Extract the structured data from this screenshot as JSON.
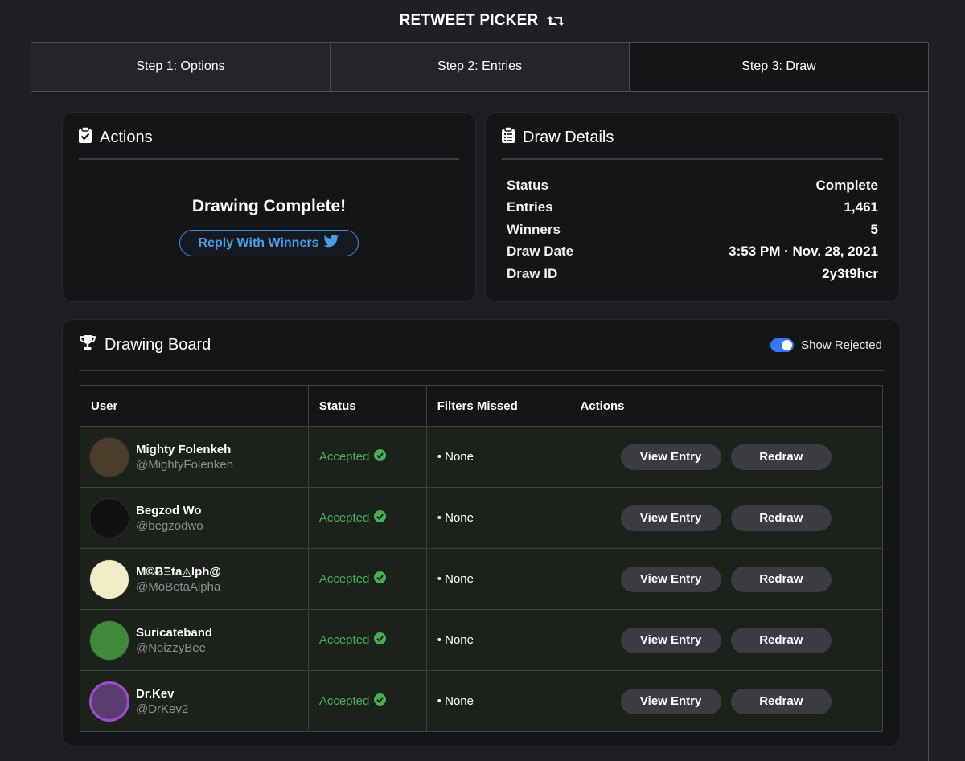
{
  "app": {
    "title": "RETWEET PICKER",
    "title_icon": "retweet-icon"
  },
  "tabs": [
    {
      "label": "Step 1: Options",
      "active": false
    },
    {
      "label": "Step 2: Entries",
      "active": false
    },
    {
      "label": "Step 3: Draw",
      "active": true
    }
  ],
  "actions": {
    "heading": "Actions",
    "icon": "clipboard-check-icon",
    "message": "Drawing Complete!",
    "reply_button": "Reply With Winners",
    "reply_icon": "twitter-bird-icon"
  },
  "details": {
    "heading": "Draw Details",
    "icon": "clipboard-list-icon",
    "rows": [
      {
        "key": "Status",
        "value": "Complete"
      },
      {
        "key": "Entries",
        "value": "1,461"
      },
      {
        "key": "Winners",
        "value": "5"
      },
      {
        "key": "Draw Date",
        "value": "3:53 PM · Nov. 28, 2021"
      },
      {
        "key": "Draw ID",
        "value": "2y3t9hcr"
      }
    ]
  },
  "board": {
    "heading": "Drawing Board",
    "icon": "trophy-icon",
    "toggle_label": "Show Rejected",
    "toggle_on": true,
    "columns": [
      "User",
      "Status",
      "Filters Missed",
      "Actions"
    ],
    "view_label": "View Entry",
    "redraw_label": "Redraw",
    "rows": [
      {
        "name": "Mighty Folenkeh",
        "handle": "@MightyFolenkeh",
        "status": "Accepted",
        "filters": "• None",
        "avatar_color": "#4a3d2a"
      },
      {
        "name": "Begzod Wo",
        "handle": "@begzodwo",
        "status": "Accepted",
        "filters": "• None",
        "avatar_color": "#111111"
      },
      {
        "name": "M©ɃΞta◬lph@",
        "handle": "@MoBetaAlpha",
        "status": "Accepted",
        "filters": "• None",
        "avatar_color": "#f3ecc8"
      },
      {
        "name": "Suricateband",
        "handle": "@NoizzyBee",
        "status": "Accepted",
        "filters": "• None",
        "avatar_color": "#3f8a3a"
      },
      {
        "name": "Dr.Kev",
        "handle": "@DrKev2",
        "status": "Accepted",
        "filters": "• None",
        "avatar_color": "#5a3c6e"
      }
    ]
  },
  "colors": {
    "accent_blue": "#3478f6",
    "accepted_green": "#4aae59",
    "reply_blue": "#4a9ee8"
  }
}
